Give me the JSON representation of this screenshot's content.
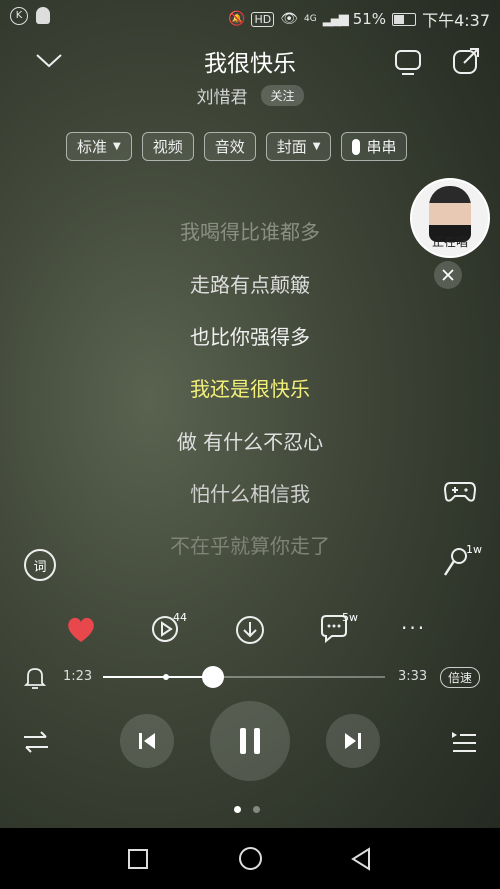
{
  "status": {
    "carrier_icons": [
      "k-icon",
      "qq-icon"
    ],
    "network": "4G",
    "battery": "51%",
    "time": "下午4:37"
  },
  "header": {
    "song_title": "我很快乐",
    "artist": "刘惜君",
    "follow_label": "关注"
  },
  "options": {
    "quality": "标准",
    "video": "视频",
    "effect": "音效",
    "cover": "封面",
    "chuan": "串串"
  },
  "floating": {
    "singing_label": "正在唱"
  },
  "lyrics": [
    "我喝得比谁都多",
    "走路有点颠簸",
    "也比你强得多",
    "我还是很快乐",
    "做 有什么不忍心",
    "怕什么相信我",
    "不在乎就算你走了"
  ],
  "side": {
    "lyrics_btn": "词",
    "mic_count": "1w"
  },
  "actions": {
    "video_count": "44",
    "comment_count": "5w",
    "more": "···"
  },
  "progress": {
    "current": "1:23",
    "total": "3:33",
    "played_fraction": 0.39,
    "speed_label": "倍速"
  }
}
